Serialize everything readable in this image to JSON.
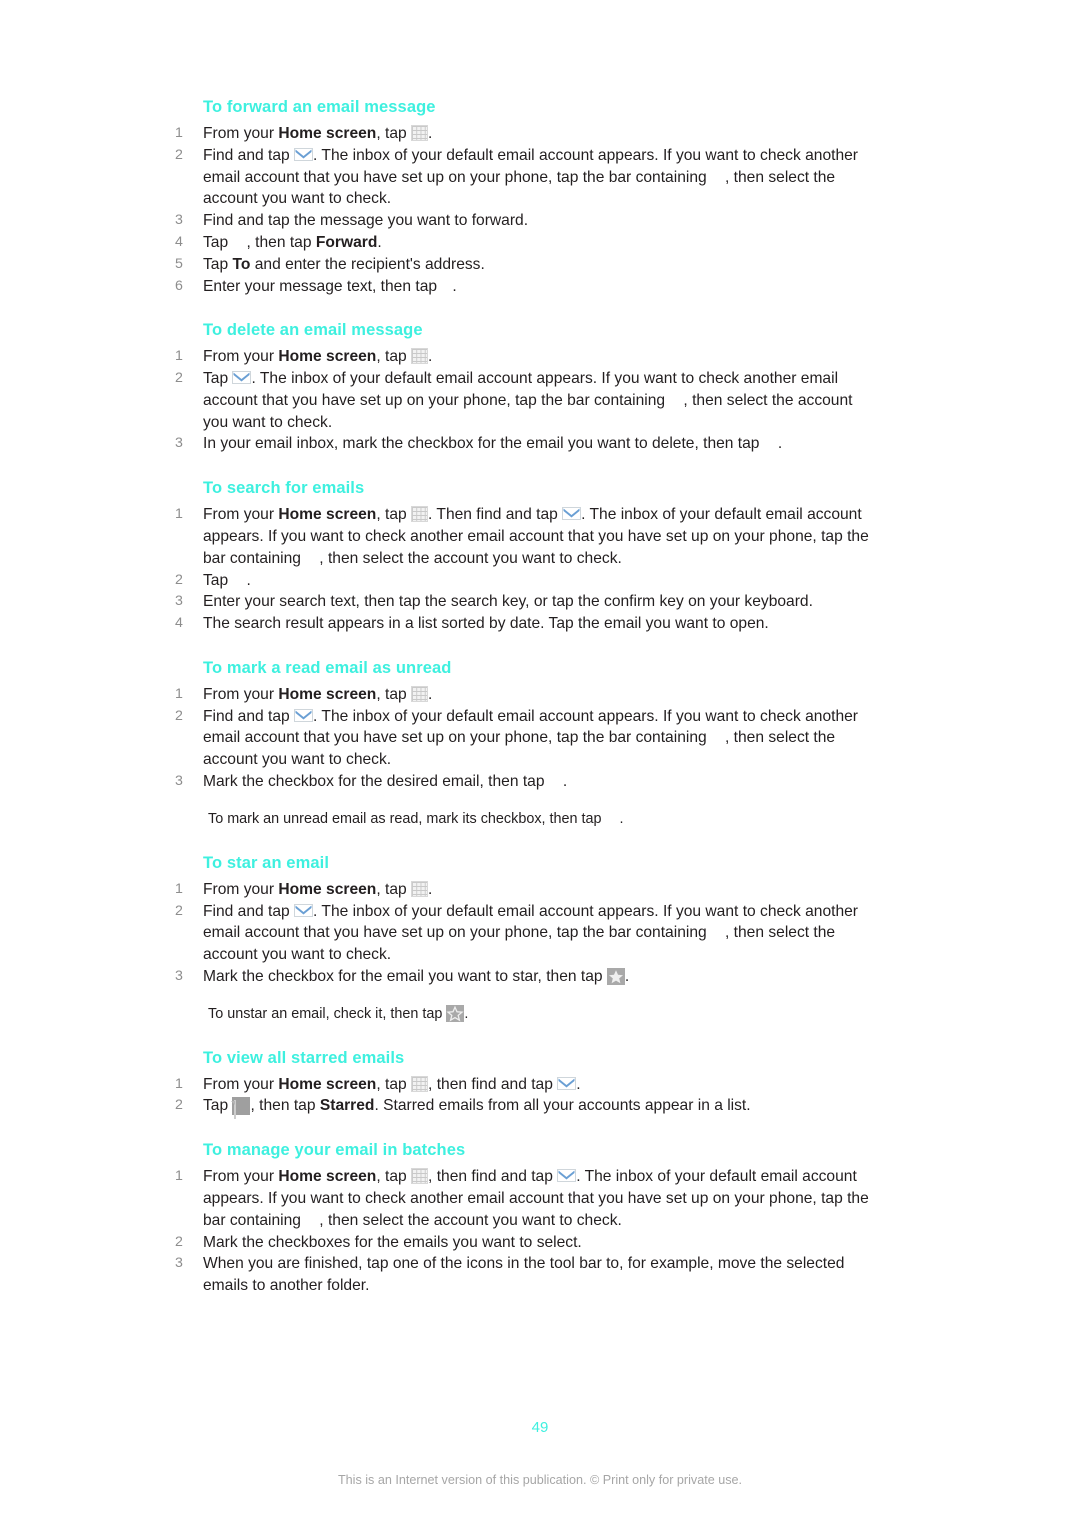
{
  "document": {
    "page_number": "49",
    "footer": "This is an Internet version of this publication. © Print only for private use.",
    "heading_color": "#3ef0df",
    "text_color": "#231f20",
    "number_color": "#8d8d8d"
  },
  "sections": [
    {
      "heading": "To forward an email message",
      "steps": [
        {
          "num": "1",
          "parts": [
            {
              "t": "From your "
            },
            {
              "b": "Home screen"
            },
            {
              "t": ", tap "
            },
            {
              "icon": "app-drawer-grid-icon"
            },
            {
              "t": "."
            }
          ]
        },
        {
          "num": "2",
          "parts": [
            {
              "t": "Find and tap "
            },
            {
              "icon": "envelope-icon"
            },
            {
              "t": ". The inbox of your default email account appears. If you want to check another email account that you have set up on your phone, tap the bar containing "
            },
            {
              "icon": "blank-glyph-icon"
            },
            {
              "t": ", then select the account you want to check."
            }
          ]
        },
        {
          "num": "3",
          "parts": [
            {
              "t": "Find and tap the message you want to forward."
            }
          ]
        },
        {
          "num": "4",
          "parts": [
            {
              "t": "Tap "
            },
            {
              "icon": "blank-glyph-icon"
            },
            {
              "t": ", then tap "
            },
            {
              "b": "Forward"
            },
            {
              "t": "."
            }
          ]
        },
        {
          "num": "5",
          "parts": [
            {
              "t": "Tap "
            },
            {
              "b": "To"
            },
            {
              "t": " and enter the recipient's address."
            }
          ]
        },
        {
          "num": "6",
          "parts": [
            {
              "t": "Enter your message text, then tap "
            },
            {
              "icon": "blank-glyph-sm-icon"
            },
            {
              "t": "."
            }
          ]
        }
      ],
      "note": null
    },
    {
      "heading": "To delete an email message",
      "steps": [
        {
          "num": "1",
          "parts": [
            {
              "t": "From your "
            },
            {
              "b": "Home screen"
            },
            {
              "t": ", tap "
            },
            {
              "icon": "app-drawer-grid-icon"
            },
            {
              "t": "."
            }
          ]
        },
        {
          "num": "2",
          "parts": [
            {
              "t": "Tap "
            },
            {
              "icon": "envelope-icon"
            },
            {
              "t": ". The inbox of your default email account appears. If you want to check another email account that you have set up on your phone, tap the bar containing "
            },
            {
              "icon": "blank-glyph-icon"
            },
            {
              "t": ", then select the account you want to check."
            }
          ]
        },
        {
          "num": "3",
          "parts": [
            {
              "t": "In your email inbox, mark the checkbox for the email you want to delete, then tap "
            },
            {
              "icon": "blank-glyph-icon"
            },
            {
              "t": "."
            }
          ]
        }
      ],
      "note": null
    },
    {
      "heading": "To search for emails",
      "steps": [
        {
          "num": "1",
          "parts": [
            {
              "t": "From your "
            },
            {
              "b": "Home screen"
            },
            {
              "t": ", tap "
            },
            {
              "icon": "app-drawer-grid-icon"
            },
            {
              "t": ". Then find and tap "
            },
            {
              "icon": "envelope-icon"
            },
            {
              "t": ". The inbox of your default email account appears. If you want to check another email account that you have set up on your phone, tap the bar containing "
            },
            {
              "icon": "blank-glyph-icon"
            },
            {
              "t": ", then select the account you want to check."
            }
          ]
        },
        {
          "num": "2",
          "parts": [
            {
              "t": "Tap "
            },
            {
              "icon": "blank-glyph-icon"
            },
            {
              "t": "."
            }
          ]
        },
        {
          "num": "3",
          "parts": [
            {
              "t": "Enter your search text, then tap the search key, or tap the confirm key on your keyboard."
            }
          ]
        },
        {
          "num": "4",
          "parts": [
            {
              "t": "The search result appears in a list sorted by date. Tap the email you want to open."
            }
          ]
        }
      ],
      "note": null
    },
    {
      "heading": "To mark a read email as unread",
      "steps": [
        {
          "num": "1",
          "parts": [
            {
              "t": "From your "
            },
            {
              "b": "Home screen"
            },
            {
              "t": ", tap "
            },
            {
              "icon": "app-drawer-grid-icon"
            },
            {
              "t": "."
            }
          ]
        },
        {
          "num": "2",
          "parts": [
            {
              "t": "Find and tap "
            },
            {
              "icon": "envelope-icon"
            },
            {
              "t": ". The inbox of your default email account appears. If you want to check another email account that you have set up on your phone, tap the bar containing "
            },
            {
              "icon": "blank-glyph-icon"
            },
            {
              "t": ", then select the account you want to check."
            }
          ]
        },
        {
          "num": "3",
          "parts": [
            {
              "t": "Mark the checkbox for the desired email, then tap "
            },
            {
              "icon": "blank-glyph-icon"
            },
            {
              "t": "."
            }
          ]
        }
      ],
      "note": {
        "parts": [
          {
            "t": "To mark an unread email as read, mark its checkbox, then tap "
          },
          {
            "icon": "blank-glyph-icon"
          },
          {
            "t": "."
          }
        ]
      }
    },
    {
      "heading": "To star an email",
      "steps": [
        {
          "num": "1",
          "parts": [
            {
              "t": "From your "
            },
            {
              "b": "Home screen"
            },
            {
              "t": ", tap "
            },
            {
              "icon": "app-drawer-grid-icon"
            },
            {
              "t": "."
            }
          ]
        },
        {
          "num": "2",
          "parts": [
            {
              "t": "Find and tap "
            },
            {
              "icon": "envelope-icon"
            },
            {
              "t": ". The inbox of your default email account appears. If you want to check another email account that you have set up on your phone, tap the bar containing "
            },
            {
              "icon": "blank-glyph-icon"
            },
            {
              "t": ", then select the account you want to check."
            }
          ]
        },
        {
          "num": "3",
          "parts": [
            {
              "t": "Mark the checkbox for the email you want to star, then tap "
            },
            {
              "icon": "star-filled-icon"
            },
            {
              "t": "."
            }
          ]
        }
      ],
      "note": {
        "parts": [
          {
            "t": "To unstar an email, check it, then tap "
          },
          {
            "icon": "star-outline-icon"
          },
          {
            "t": "."
          }
        ]
      }
    },
    {
      "heading": "To view all starred emails",
      "steps": [
        {
          "num": "1",
          "parts": [
            {
              "t": "From your "
            },
            {
              "b": "Home screen"
            },
            {
              "t": ", tap "
            },
            {
              "icon": "app-drawer-grid-icon"
            },
            {
              "t": ", then find and tap "
            },
            {
              "icon": "envelope-icon"
            },
            {
              "t": "."
            }
          ]
        },
        {
          "num": "2",
          "parts": [
            {
              "t": "Tap "
            },
            {
              "icon": "folder-icon"
            },
            {
              "t": ", then tap "
            },
            {
              "b": "Starred"
            },
            {
              "t": ". Starred emails from all your accounts appear in a list."
            }
          ]
        }
      ],
      "note": null
    },
    {
      "heading": "To manage your email in batches",
      "steps": [
        {
          "num": "1",
          "parts": [
            {
              "t": "From your "
            },
            {
              "b": "Home screen"
            },
            {
              "t": ", tap "
            },
            {
              "icon": "app-drawer-grid-icon"
            },
            {
              "t": ", then find and tap "
            },
            {
              "icon": "envelope-icon"
            },
            {
              "t": ". The inbox of your default email account appears. If you want to check another email account that you have set up on your phone, tap the bar containing "
            },
            {
              "icon": "blank-glyph-icon"
            },
            {
              "t": ", then select the account you want to check."
            }
          ]
        },
        {
          "num": "2",
          "parts": [
            {
              "t": "Mark the checkboxes for the emails you want to select."
            }
          ]
        },
        {
          "num": "3",
          "parts": [
            {
              "t": "When you are finished, tap one of the icons in the tool bar to, for example, move the selected emails to another folder."
            }
          ]
        }
      ],
      "note": null
    }
  ]
}
